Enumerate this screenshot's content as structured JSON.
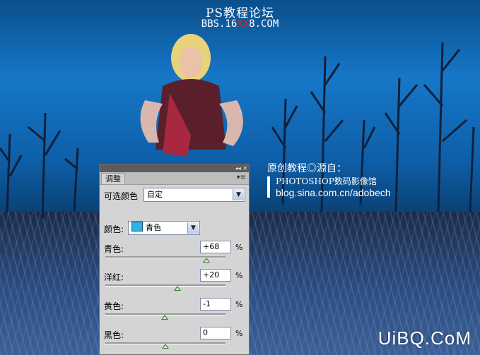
{
  "watermark": {
    "title": "PS教程论坛",
    "url_prefix": "BBS.16",
    "url_mid": "XX",
    "url_suffix": "8.COM"
  },
  "credit": {
    "line1": "原创教程◎源自：",
    "line2": "PHOTOSHOP数码影像馆",
    "line3": "blog.sina.com.cn/adobech"
  },
  "logo": "UiBQ.CoM",
  "panel": {
    "tab_label": "调整",
    "preset_label": "可选颜色",
    "preset_value": "自定",
    "color_label": "颜色:",
    "color_value": "青色",
    "sliders": [
      {
        "label": "青色:",
        "value": "+68",
        "unit": "%",
        "level": 0.84
      },
      {
        "label": "洋红:",
        "value": "+20",
        "unit": "%",
        "level": 0.6
      },
      {
        "label": "黄色:",
        "value": "-1",
        "unit": "%",
        "level": 0.495
      },
      {
        "label": "黑色:",
        "value": "0",
        "unit": "%",
        "level": 0.5
      }
    ]
  },
  "colors": {
    "accent_swatch": "#29b3e6",
    "sky": "#1677c8",
    "panel_bg": "#d4d4d4"
  }
}
